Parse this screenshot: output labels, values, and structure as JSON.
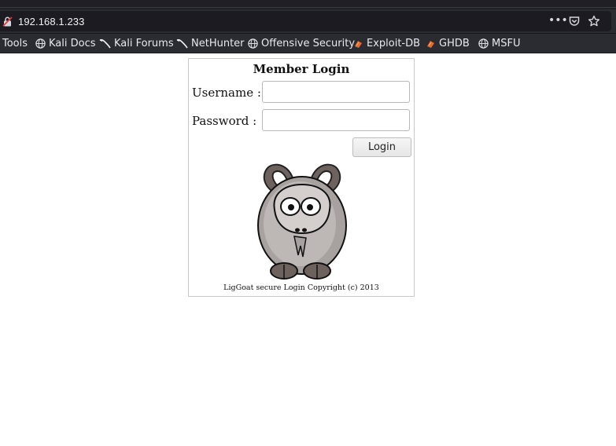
{
  "browser": {
    "url": "192.168.1.233",
    "page_actions_glyph": "•••"
  },
  "bookmarks": [
    {
      "label": "Tools",
      "icon": "none"
    },
    {
      "label": "Kali Docs",
      "icon": "globe-icon"
    },
    {
      "label": "Kali Forums",
      "icon": "kali-dragon-icon"
    },
    {
      "label": "NetHunter",
      "icon": "kali-dragon-icon"
    },
    {
      "label": "Offensive Security",
      "icon": "globe-icon"
    },
    {
      "label": "Exploit-DB",
      "icon": "exploit-db-icon"
    },
    {
      "label": "GHDB",
      "icon": "exploit-db-icon"
    },
    {
      "label": "MSFU",
      "icon": "globe-icon"
    }
  ],
  "login": {
    "title": "Member Login",
    "username_label": "Username :",
    "username_value": "",
    "password_label": "Password :",
    "password_value": "",
    "button_label": "Login",
    "copyright": "LigGoat secure Login Copyright (c) 2013"
  },
  "colors": {
    "chrome_bg": "#2b2b32",
    "url_field_bg": "#1c1b22",
    "exploit_db_orange": "#e8692c"
  }
}
